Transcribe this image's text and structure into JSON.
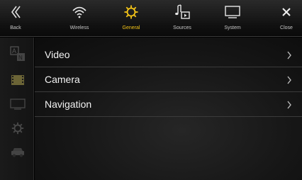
{
  "topbar": {
    "back": {
      "label": "Back",
      "icon": "double-chevron-left-icon"
    },
    "tabs": [
      {
        "label": "Wireless",
        "icon": "wifi-icon",
        "active": false
      },
      {
        "label": "General",
        "icon": "gear-icon",
        "active": true
      },
      {
        "label": "Sources",
        "icon": "music-note-icon",
        "active": false
      },
      {
        "label": "System",
        "icon": "monitor-icon",
        "active": false
      }
    ],
    "close": {
      "label": "Close",
      "icon": "close-icon"
    }
  },
  "sidebar": {
    "items": [
      {
        "icon": "language-icon"
      },
      {
        "icon": "film-icon"
      },
      {
        "icon": "display-icon"
      },
      {
        "icon": "gear-icon"
      },
      {
        "icon": "car-icon"
      }
    ]
  },
  "menu": {
    "items": [
      {
        "label": "Video"
      },
      {
        "label": "Camera"
      },
      {
        "label": "Navigation"
      }
    ]
  },
  "colors": {
    "accent": "#f5c518",
    "background": "#000000",
    "divider": "#3b3b3b",
    "inactive_text": "#c8c8c8"
  }
}
